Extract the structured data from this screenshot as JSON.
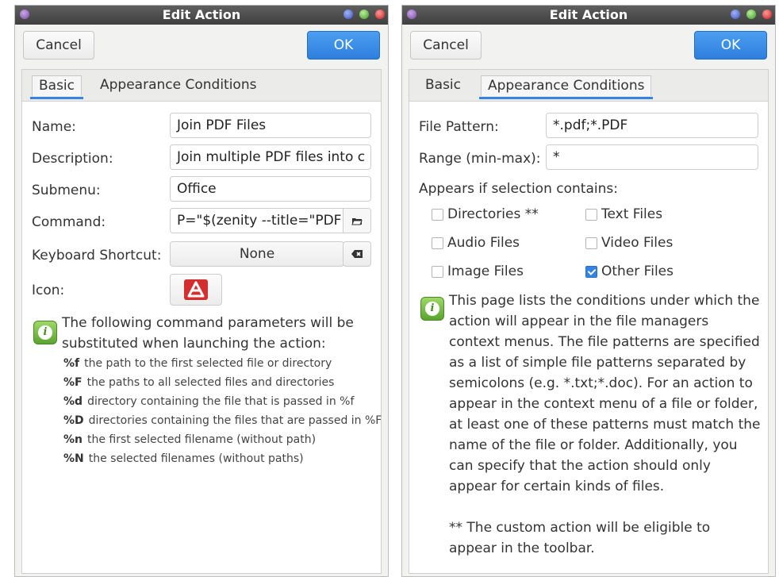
{
  "left": {
    "title": "Edit Action",
    "cancel": "Cancel",
    "ok": "OK",
    "tabs": [
      "Basic",
      "Appearance Conditions"
    ],
    "fields": {
      "name_label": "Name:",
      "name_value": "Join PDF Files",
      "description_label": "Description:",
      "description_value": "Join multiple PDF files into c",
      "submenu_label": "Submenu:",
      "submenu_value": "Office",
      "command_label": "Command:",
      "command_value": "P=\"$(zenity --title=\"PDF J",
      "shortcut_label": "Keyboard Shortcut:",
      "shortcut_value": "None",
      "icon_label": "Icon:"
    },
    "info_text": "The following command parameters will be substituted when launching the action:",
    "params": [
      {
        "code": "%f",
        "desc": "the path to the first selected file or directory"
      },
      {
        "code": "%F",
        "desc": "the paths to all selected files and directories"
      },
      {
        "code": "%d",
        "desc": "directory containing the file that is passed in %f"
      },
      {
        "code": "%D",
        "desc": "directories containing the files that are passed in %F"
      },
      {
        "code": "%n",
        "desc": "the first selected filename (without path)"
      },
      {
        "code": "%N",
        "desc": "the selected filenames (without paths)"
      }
    ]
  },
  "right": {
    "title": "Edit Action",
    "cancel": "Cancel",
    "ok": "OK",
    "tabs": [
      "Basic",
      "Appearance Conditions"
    ],
    "file_pattern_label": "File Pattern:",
    "file_pattern_value": "*.pdf;*.PDF",
    "range_label": "Range (min-max):",
    "range_value": "*",
    "appears_label": "Appears if selection contains:",
    "checkboxes": [
      {
        "label": "Directories **",
        "checked": false
      },
      {
        "label": "Text Files",
        "checked": false
      },
      {
        "label": "Audio Files",
        "checked": false
      },
      {
        "label": "Video Files",
        "checked": false
      },
      {
        "label": "Image Files",
        "checked": false
      },
      {
        "label": "Other Files",
        "checked": true
      }
    ],
    "info_lines": [
      "This page lists the conditions under which the",
      "action will appear in the file managers",
      "context menus. The file patterns are specified",
      "as a list of simple file patterns separated by",
      "semicolons (e.g. *.txt;*.doc). For an action to",
      "appear in the context menu of a file or folder,",
      "at least one of these patterns must match the",
      "name of the file or folder. Additionally, you",
      "can specify that the action should only",
      "appear for certain kinds of files."
    ],
    "note_lines": [
      "** The custom action will be eligible to",
      "appear in the toolbar."
    ]
  },
  "colors": {
    "accent": "#3584e4",
    "titlebar": "#4a4a4a"
  }
}
